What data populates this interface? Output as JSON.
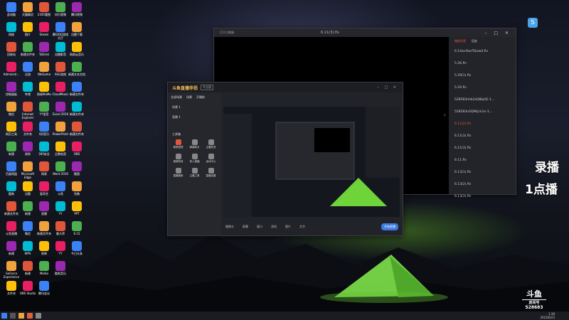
{
  "desktop": {
    "icons": [
      [
        "此电脑",
        "天猫精灵",
        "2345看图",
        "风行视频",
        "腾讯视频"
      ],
      [
        "网络",
        "图片",
        "Steam",
        "腾讯QQ游戏大厅",
        "迅雷下载"
      ],
      [
        "回收站",
        "新建文件夹",
        "ToDesk",
        "迅雷影音",
        "网易云音乐"
      ],
      [
        "Administr...",
        "迅游",
        "WeGame",
        "ASG游戏",
        "新建文本文档"
      ],
      [
        "控制面板",
        "哔哩",
        "网易MuMu",
        "CloudMusic",
        "新建文件夹"
      ],
      [
        "微信",
        "Internet Explorer",
        "YY语音",
        "Excel 2016",
        "新建文件夹"
      ],
      [
        "网页工具",
        "文件夹",
        "QQ音乐",
        "PowerPoint",
        "新建文件夹"
      ],
      [
        "新建",
        "易剪",
        "360安全",
        "企鹅电竞",
        "OBS"
      ],
      [
        "百度网盘",
        "Microsoft Edge",
        "网易",
        "Word 2016",
        "截图"
      ],
      [
        "酷狗",
        "迅雷",
        "爱奇艺",
        "斗鱼",
        "完美"
      ],
      [
        "新建文件夹",
        "新建",
        "直播",
        "YY",
        "PPT"
      ],
      [
        "斗鱼直播",
        "微信",
        "新建文件夹",
        "鲁大师",
        "6.15"
      ],
      [
        "新建",
        "WPS",
        "剪映",
        "YY",
        "今日头条"
      ],
      [
        "GeForce Experience",
        "新建",
        "Media",
        "酷狗音乐",
        ""
      ],
      [
        "文件夹",
        "OBS Studio",
        "腾讯会议",
        "",
        ""
      ]
    ]
  },
  "player": {
    "title": "6.11(3).flv",
    "left_label": "打开主播端",
    "tabs": [
      "播放列表",
      "历史"
    ],
    "playlist": [
      "6.14ac4lw.f5kow4.flv",
      "5.26.flv",
      "5.29(1).flv",
      "5.29.flv",
      "528583nhb2zQ8bjAE-1...",
      "528583nSQ9Kjck1n-1...",
      "6.11(2).flv",
      "6.11(3).flv",
      "6.11(3).flv",
      "6.11.flv",
      "6.13(1).flv",
      "6.13(2).flv",
      "6.13(3).flv"
    ],
    "active_index": 6
  },
  "livewin": {
    "brand": "斗鱼直播伴侣",
    "badge": "专业版",
    "tabs": [
      "全部场景",
      "场景",
      "开播前"
    ],
    "sections": [
      "场景 1",
      "直播 1"
    ],
    "toolbox_title": "工具箱",
    "tools": [
      "美颜滤镜",
      "弹幕助手",
      "主播任务",
      "视频特效",
      "录入直播",
      "活动中心",
      "直播管家",
      "主播工具",
      "直播设置"
    ],
    "bottom_items": [
      "摄像头",
      "屏幕",
      "窗口",
      "游戏",
      "图片",
      "文字",
      "开始直播"
    ]
  },
  "overlay": {
    "line1": "录播",
    "line2": "1点播"
  },
  "watermark": {
    "brand": "斗鱼",
    "label": "房间号",
    "room": "528683"
  },
  "taskbar": {
    "time": "1:38",
    "date": "2023/6/23"
  }
}
